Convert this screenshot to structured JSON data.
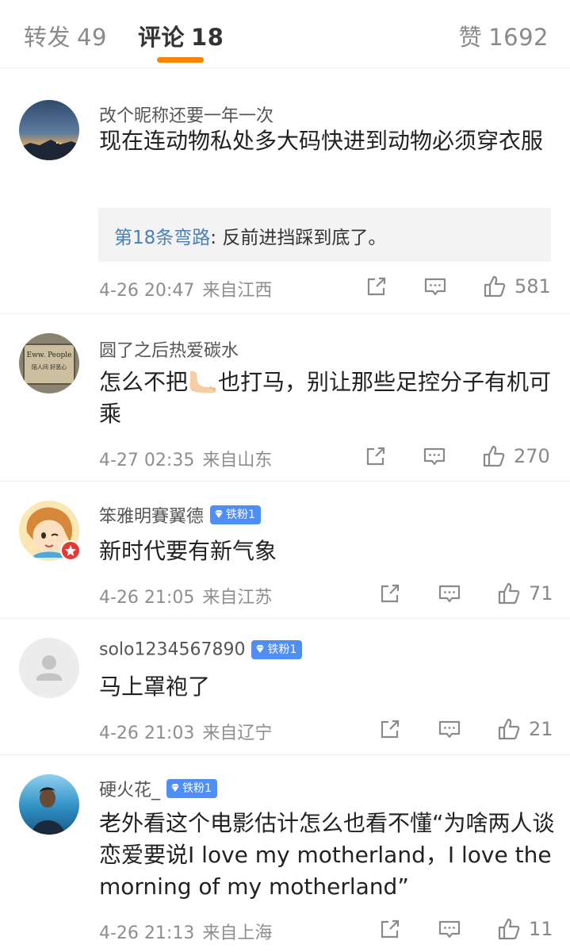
{
  "tabs": {
    "repost": {
      "label": "转发",
      "count": "49"
    },
    "comment": {
      "label": "评论",
      "count": "18"
    },
    "like": {
      "label": "赞",
      "count": "1692"
    }
  },
  "comments": [
    {
      "username": "改个昵称还要一年一次",
      "text": "现在连动物私处多大码快进到动物必须穿衣服",
      "reply": {
        "user": "第18条弯路",
        "sep": ":",
        "text": " 反前进挡踩到底了。"
      },
      "time": "4-26 20:47",
      "location": "来自江西",
      "likes": "581"
    },
    {
      "username": "圆了之后热爱碳水",
      "text_before_emoji": "怎么不把",
      "emoji": "foot-emoji",
      "text_after_emoji": "也打马，别让那些足控分子有机可乘",
      "time": "4-27 02:35",
      "location": "来自山东",
      "likes": "270",
      "avatar_text_1": "Eww. People",
      "avatar_text_2": "陌人间 好恶心"
    },
    {
      "username": "笨雅明賽翼德",
      "badge": "铁粉1",
      "text": "新时代要有新气象",
      "time": "4-26 21:05",
      "location": "来自江苏",
      "likes": "71"
    },
    {
      "username": "solo1234567890",
      "badge": "铁粉1",
      "text": "马上罩袍了",
      "time": "4-26 21:03",
      "location": "来自辽宁",
      "likes": "21"
    },
    {
      "username": "硬火花_",
      "badge": "铁粉1",
      "text": "老外看这个电影估计怎么也看不懂“为啥两人谈恋爱要说I love my motherland，I love the morning of my motherland”",
      "time": "4-26 21:13",
      "location": "来自上海",
      "likes": "11"
    }
  ],
  "icons": {
    "share": "share-icon",
    "comment": "comment-icon",
    "like": "thumbs-up-icon",
    "badge_gem": "diamond-icon",
    "default_avatar": "user-silhouette-icon"
  },
  "colors": {
    "accent": "#ff8200",
    "reply_user": "#4a7fb8",
    "fan_badge": "#4e8ef7"
  }
}
